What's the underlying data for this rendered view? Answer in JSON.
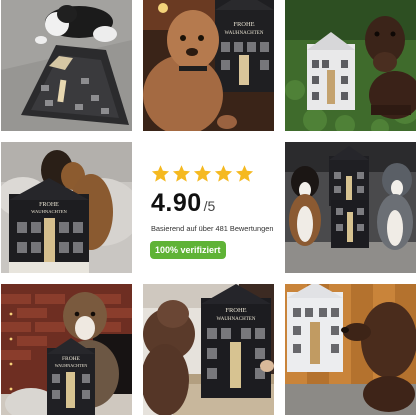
{
  "review": {
    "rating_value": "4.90",
    "rating_max": "/5",
    "stars": 5,
    "based_on": "Basierend auf über 481 Bewertungen",
    "verified_badge": "100% verifiziert",
    "colors": {
      "star": "#f5b920",
      "badge": "#5fb336"
    }
  },
  "calendar": {
    "title_line1": "FROHE",
    "title_line2": "WAUHNACHTEN"
  },
  "photos": [
    {
      "subject": "border collie lying next to advent calendar on grey floor"
    },
    {
      "subject": "brown lagotto dog next to advent calendar"
    },
    {
      "subject": "brown labrador on grass with advent calendar"
    },
    {
      "subject": "shepherd dog on sofa behind advent calendar"
    },
    {
      "subject": "two australian shepherds on grey sofa with calendars"
    },
    {
      "subject": "australian shepherd by brick fireplace holding calendar"
    },
    {
      "subject": "curly brown dog with advent calendar on box"
    },
    {
      "subject": "brown dog sniffing advent calendar on wooden floor"
    }
  ]
}
